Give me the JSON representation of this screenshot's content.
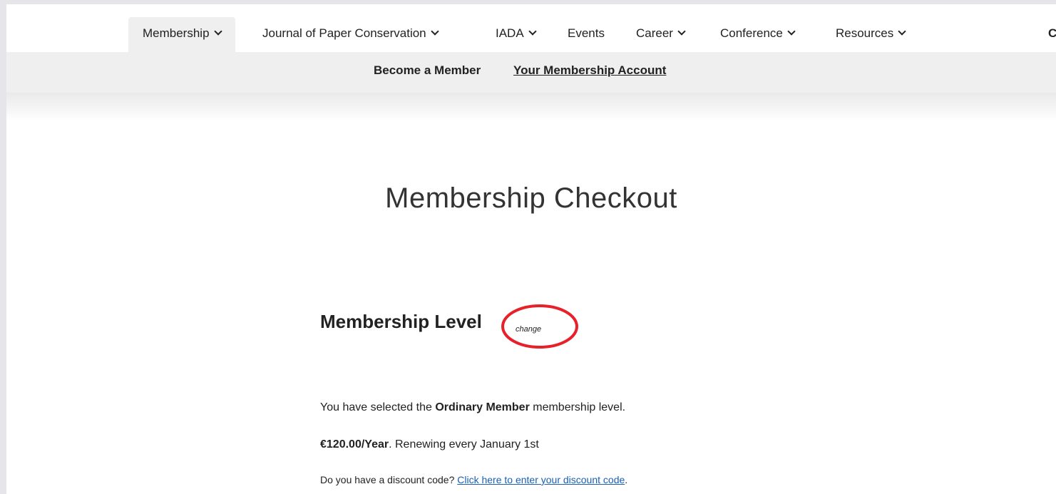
{
  "nav": {
    "items": [
      {
        "label": "Membership",
        "has_dropdown": true,
        "active": true
      },
      {
        "label": "Journal of Paper Conservation",
        "has_dropdown": true
      },
      {
        "label": "IADA",
        "has_dropdown": true
      },
      {
        "label": "Events",
        "has_dropdown": false
      },
      {
        "label": "Career",
        "has_dropdown": true
      },
      {
        "label": "Conference",
        "has_dropdown": true
      },
      {
        "label": "Resources",
        "has_dropdown": true
      },
      {
        "label": "C",
        "has_dropdown": false
      }
    ]
  },
  "subnav": {
    "become_member": "Become a Member",
    "account": "Your Membership Account"
  },
  "page": {
    "title": "Membership Checkout"
  },
  "level": {
    "heading": "Membership Level",
    "change_label": "change",
    "selected_prefix": "You have selected the ",
    "selected_level": "Ordinary Member",
    "selected_suffix": " membership level.",
    "price": "€120.00/Year",
    "renewal": ". Renewing every January 1st",
    "discount_question": "Do you have a discount code? ",
    "discount_link": "Click here to enter your discount code",
    "discount_end": "."
  },
  "colors": {
    "highlight": "#e8202a",
    "link": "#1a5fb4"
  }
}
